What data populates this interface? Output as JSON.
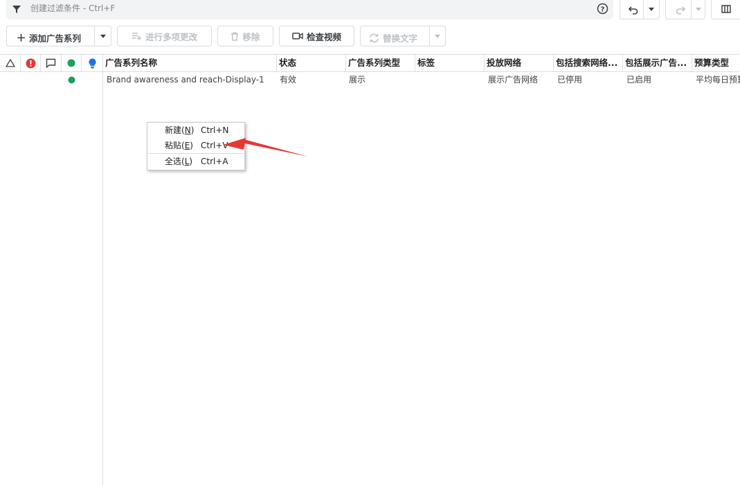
{
  "filter": {
    "placeholder": "创建过滤条件 - Ctrl+F"
  },
  "toolbar": {
    "add_campaign": "添加广告系列",
    "bulk_edit": "进行多项更改",
    "remove": "移除",
    "check_video": "检查视频",
    "replace_text": "替换文字"
  },
  "columns": [
    "广告系列名称",
    "状态",
    "广告系列类型",
    "标签",
    "投放网络",
    "包括搜索网络...",
    "包括展示广告...",
    "预算类型"
  ],
  "rows": [
    {
      "name": "Brand awareness and reach-Display-1",
      "status": "有效",
      "type": "展示",
      "label": "",
      "network": "展示广告网络",
      "search_network": "已停用",
      "display_network": "已启用",
      "budget_type": "平均每日预算"
    }
  ],
  "context_menu": {
    "new": {
      "text": "新建",
      "mnemonic": "N",
      "shortcut": "Ctrl+N"
    },
    "paste": {
      "text": "粘贴",
      "mnemonic": "E",
      "shortcut": "Ctrl+V"
    },
    "select_all": {
      "text": "全选",
      "mnemonic": "L",
      "shortcut": "Ctrl+A"
    }
  },
  "colors": {
    "error": "#e53935",
    "status_green": "#1e9e5a",
    "bulb_blue": "#1a73e8",
    "annotation_arrow": "#e53935"
  },
  "icons": [
    "filter-icon",
    "help-icon",
    "undo-icon",
    "redo-icon",
    "columns-icon",
    "plus-icon",
    "edit-list-icon",
    "trash-icon",
    "video-icon",
    "replace-icon",
    "warning-triangle-icon",
    "error-icon",
    "comment-icon",
    "status-dot-icon",
    "lightbulb-icon"
  ]
}
